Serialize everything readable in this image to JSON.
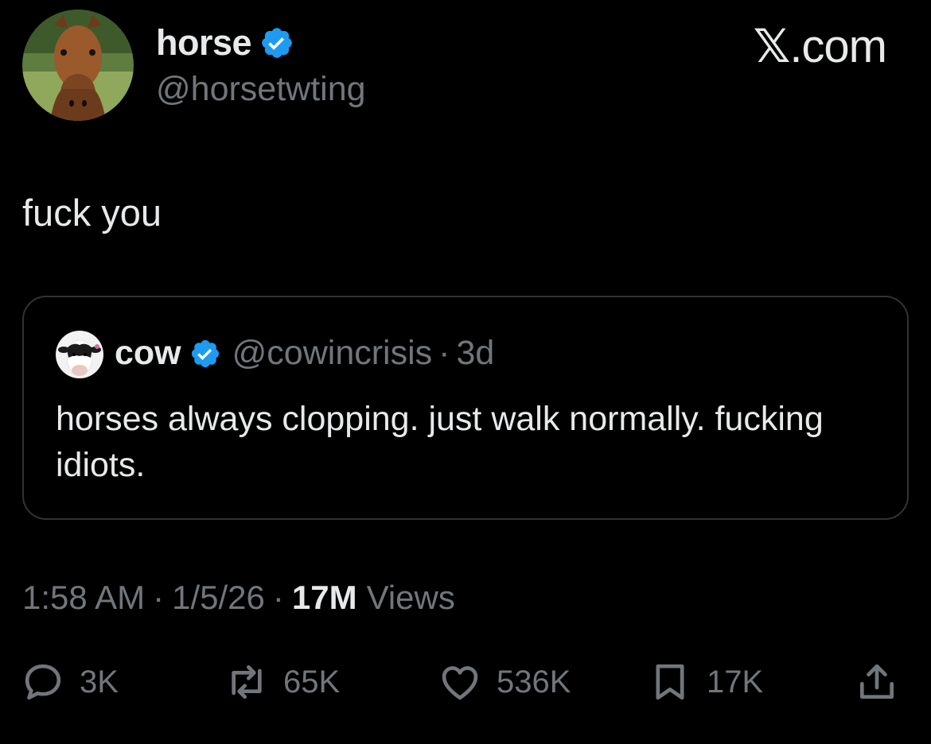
{
  "author": {
    "display_name": "horse",
    "handle": "@horsetwting",
    "verified": true,
    "avatar": "horse-photo-avatar"
  },
  "brand": {
    "label": "𝕏.com",
    "prefix": "𝕏",
    "suffix": ".com"
  },
  "tweet": {
    "text": "fuck you"
  },
  "quoted_tweet": {
    "display_name": "cow",
    "handle": "@cowincrisis",
    "separator": "·",
    "time": "3d",
    "verified": true,
    "avatar": "cow-photo-avatar",
    "text": "horses always clopping. just walk normally. fucking idiots."
  },
  "meta": {
    "time": "1:58 AM",
    "separator": "·",
    "date": "1/5/26",
    "views_count": "17M",
    "views_label": "Views"
  },
  "actions": {
    "reply": {
      "icon": "reply-bubble-icon",
      "count": "3K"
    },
    "repost": {
      "icon": "repost-icon",
      "count": "65K"
    },
    "like": {
      "icon": "heart-icon",
      "count": "536K"
    },
    "bookmark": {
      "icon": "bookmark-icon",
      "count": "17K"
    },
    "share": {
      "icon": "share-icon"
    }
  },
  "colors": {
    "background": "#000000",
    "primary_text": "#e7e9ea",
    "secondary_text": "#71767b",
    "border": "#2f3336",
    "verified_blue": "#1d9bf0"
  }
}
